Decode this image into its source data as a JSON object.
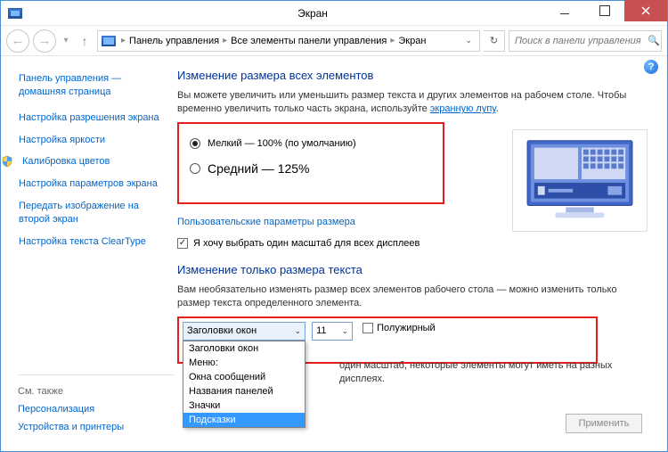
{
  "titlebar": {
    "title": "Экран"
  },
  "breadcrumb": {
    "items": [
      "Панель управления",
      "Все элементы панели управления",
      "Экран"
    ]
  },
  "search": {
    "placeholder": "Поиск в панели управления"
  },
  "sidebar": {
    "home": "Панель управления — домашняя страница",
    "links": [
      "Настройка разрешения экрана",
      "Настройка яркости",
      "Калибровка цветов",
      "Настройка параметров экрана",
      "Передать изображение на второй экран",
      "Настройка текста ClearType"
    ],
    "see_also": "См. также",
    "bottom_links": [
      "Персонализация",
      "Устройства и принтеры"
    ]
  },
  "main": {
    "h1": "Изменение размера всех элементов",
    "desc_a": "Вы можете увеличить или уменьшить размер текста и других элементов на рабочем столе. Чтобы временно увеличить только часть экрана, используйте ",
    "desc_link": "экранную лупу",
    "radio_small": "Мелкий — 100% (по умолчанию)",
    "radio_medium": "Средний — 125%",
    "custom_link": "Пользовательские параметры размера",
    "checkbox_label": "Я хочу выбрать один масштаб для всех дисплеев",
    "h2": "Изменение только размера текста",
    "desc2": "Вам необязательно изменять размер всех элементов рабочего стола — можно изменить только размер текста определенного элемента.",
    "element_select": {
      "value": "Заголовки окон",
      "options": [
        "Заголовки окон",
        "Меню:",
        "Окна сообщений",
        "Названия панелей",
        "Значки",
        "Подсказки"
      ]
    },
    "size_select": {
      "value": "11"
    },
    "bold_label": "Полужирный",
    "behind_text": "один масштаб, некоторые элементы могут иметь на разных дисплеях.",
    "apply": "Применить"
  }
}
